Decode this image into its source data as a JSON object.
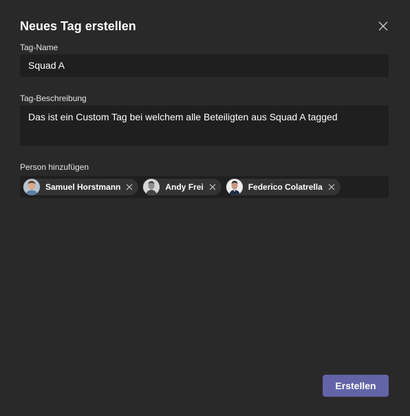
{
  "dialog": {
    "title": "Neues Tag erstellen",
    "close_icon": "close-icon"
  },
  "tag_name": {
    "label": "Tag-Name",
    "value": "Squad A"
  },
  "tag_description": {
    "label": "Tag-Beschreibung",
    "value": "Das ist ein Custom Tag bei welchem alle Beteiligten aus Squad A tagged"
  },
  "people": {
    "label": "Person hinzufügen",
    "members": [
      {
        "name": "Samuel Horstmann",
        "avatar": "avatar-photo",
        "remove_icon": "close-icon"
      },
      {
        "name": "Andy Frei",
        "avatar": "avatar-photo",
        "remove_icon": "close-icon"
      },
      {
        "name": "Federico Colatrella",
        "avatar": "avatar-photo",
        "remove_icon": "close-icon"
      }
    ]
  },
  "actions": {
    "create_label": "Erstellen"
  },
  "colors": {
    "background": "#292929",
    "input_background": "#1f1f1f",
    "chip_background": "#333333",
    "accent": "#6264a7",
    "text": "#ffffff"
  }
}
